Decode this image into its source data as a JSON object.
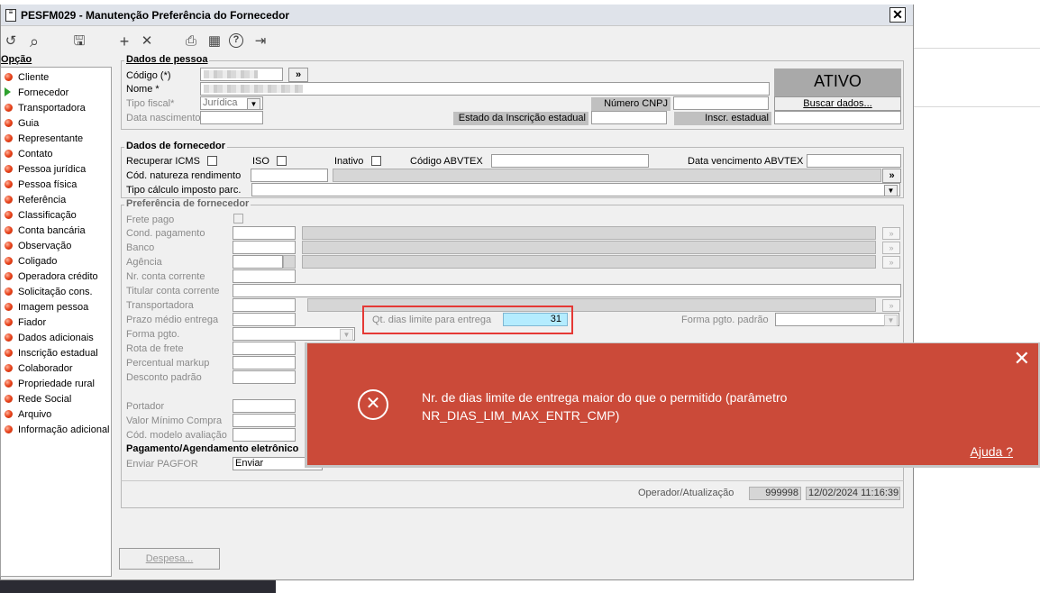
{
  "window": {
    "title": "PESFM029 - Manutenção Preferência do Fornecedor",
    "title_icon": "document-icon",
    "close_glyph": "✕"
  },
  "toolbar": {
    "icons": [
      {
        "name": "undo-icon",
        "glyph": "↺"
      },
      {
        "name": "search-icon",
        "glyph": "⌕"
      },
      {
        "name": "save-icon",
        "glyph": "🖫"
      },
      {
        "name": "add-icon",
        "glyph": "+"
      },
      {
        "name": "delete-icon",
        "glyph": "✕"
      },
      {
        "name": "print-icon",
        "glyph": "⎙"
      },
      {
        "name": "calendar-icon",
        "glyph": "▦"
      },
      {
        "name": "help-icon",
        "glyph": "?"
      },
      {
        "name": "exit-icon",
        "glyph": "⇥"
      }
    ]
  },
  "sidebar": {
    "title": "Opção",
    "items": [
      {
        "label": "Cliente"
      },
      {
        "label": "Fornecedor",
        "selected": true
      },
      {
        "label": "Transportadora"
      },
      {
        "label": "Guia"
      },
      {
        "label": "Representante"
      },
      {
        "label": "Contato"
      },
      {
        "label": "Pessoa jurídica"
      },
      {
        "label": "Pessoa física"
      },
      {
        "label": "Referência"
      },
      {
        "label": "Classificação"
      },
      {
        "label": "Conta bancária"
      },
      {
        "label": "Observação"
      },
      {
        "label": "Coligado"
      },
      {
        "label": "Operadora crédito"
      },
      {
        "label": "Solicitação cons."
      },
      {
        "label": "Imagem pessoa"
      },
      {
        "label": "Fiador"
      },
      {
        "label": "Dados adicionais"
      },
      {
        "label": "Inscrição estadual"
      },
      {
        "label": "Colaborador"
      },
      {
        "label": "Propriedade rural"
      },
      {
        "label": "Rede Social"
      },
      {
        "label": "Arquivo"
      },
      {
        "label": "Informação adicional"
      }
    ]
  },
  "pessoa": {
    "legend": "Dados de pessoa",
    "codigo_label": "Código (*)",
    "codigo_btn": "»",
    "nome_label": "Nome *",
    "tipo_fiscal_label": "Tipo fiscal*",
    "tipo_fiscal_value": "Jurídica",
    "data_nasc_label": "Data nascimento",
    "numero_cnpj_label": "Número CNPJ",
    "estado_insc_label": "Estado da Inscrição estadual",
    "insc_estadual_label": "Inscr. estadual",
    "status": "ATIVO",
    "buscar_btn": "Buscar dados..."
  },
  "fornecedor": {
    "legend": "Dados de fornecedor",
    "recuperar_icms": "Recuperar ICMS",
    "iso": "ISO",
    "inativo": "Inativo",
    "codigo_abvtex": "Código ABVTEX",
    "data_venc_abvtex": "Data vencimento ABVTEX",
    "cod_natureza": "Cód. natureza rendimento",
    "cod_natureza_btn": "»",
    "tipo_calculo": "Tipo cálculo imposto parc."
  },
  "preferencia": {
    "legend": "Preferência de fornecedor",
    "frete_pago": "Frete pago",
    "cond_pagamento": "Cond. pagamento",
    "banco": "Banco",
    "agencia": "Agência",
    "nr_conta": "Nr. conta corrente",
    "titular": "Titular conta corrente",
    "transportadora": "Transportadora",
    "prazo_medio": "Prazo médio entrega",
    "qt_dias_label": "Qt. dias limite para entrega",
    "qt_dias_value": "31",
    "forma_pgto_padrao": "Forma pgto. padrão",
    "forma_pgto": "Forma pgto.",
    "rota_frete": "Rota de frete",
    "percentual_markup": "Percentual markup",
    "desconto_padrao": "Desconto padrão",
    "portador": "Portador",
    "valor_minimo": "Valor Mínimo Compra",
    "cod_modelo": "Cód. modelo avaliação",
    "side_btn": "»"
  },
  "pagamento": {
    "legend": "Pagamento/Agendamento eletrônico",
    "enviar_label": "Enviar PAGFOR",
    "enviar_value": "Enviar"
  },
  "footer": {
    "operador_label": "Operador/Atualização",
    "operador_value": "999998",
    "timestamp": "12/02/2024 11:16:39",
    "despesa_btn": "Despesa..."
  },
  "error_popup": {
    "message": "Nr. de dias limite de entrega maior do que o permitido (parâmetro NR_DIAS_LIM_MAX_ENTR_CMP)",
    "help_link": "Ajuda ?",
    "close_glyph": "✕",
    "icon_glyph": "✕"
  }
}
